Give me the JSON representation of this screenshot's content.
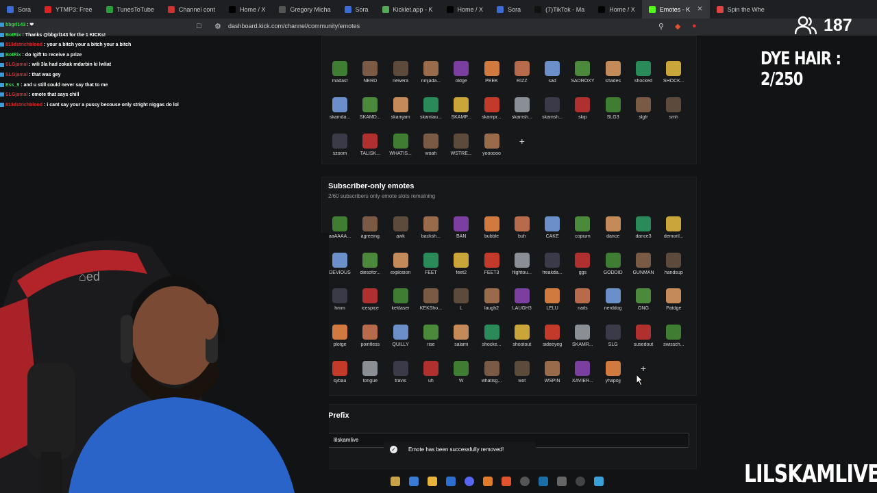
{
  "browser": {
    "tabs": [
      {
        "label": "Sora",
        "icon": "sora-icon",
        "color": "#3a6bd6"
      },
      {
        "label": "YTMP3: Free",
        "icon": "ytmp3-icon",
        "color": "#d22"
      },
      {
        "label": "TunesToTube",
        "icon": "tunestotube-icon",
        "color": "#2a9d3a"
      },
      {
        "label": "Channel cont",
        "icon": "channel-icon",
        "color": "#c33"
      },
      {
        "label": "Home / X",
        "icon": "x-icon",
        "color": "#000"
      },
      {
        "label": "Gregory Micha",
        "icon": "page-icon",
        "color": "#555"
      },
      {
        "label": "Sora",
        "icon": "sora-icon",
        "color": "#3a6bd6"
      },
      {
        "label": "Kicklet.app - K",
        "icon": "kicklet-icon",
        "color": "#5a5"
      },
      {
        "label": "Home / X",
        "icon": "x-icon",
        "color": "#000"
      },
      {
        "label": "Sora",
        "icon": "sora-icon",
        "color": "#3a6bd6"
      },
      {
        "label": "(7)TikTok - Ma",
        "icon": "tiktok-icon",
        "color": "#111"
      },
      {
        "label": "Home / X",
        "icon": "x-icon",
        "color": "#000"
      },
      {
        "label": "Emotes - K",
        "icon": "kick-icon",
        "color": "#53fc18",
        "active": true
      },
      {
        "label": "Spin the Whe",
        "icon": "wheel-icon",
        "color": "#d44"
      }
    ],
    "url": "dashboard.kick.com/channel/community/emotes"
  },
  "overlay": {
    "viewer_count": "187",
    "dye_hair": "DYE HAIR : 2/250",
    "streamer_name": "LILSKAMLIVE"
  },
  "chat": [
    {
      "user": "bbgrl143",
      "msg": "❤",
      "red": false
    },
    {
      "user": "BotRix",
      "msg": "Thanks @bbgrl143 for the 1 KICKs!",
      "red": false
    },
    {
      "user": "813dstrichblood",
      "msg": "your a bitch your a bitch your a bitch",
      "red": true
    },
    {
      "user": "BotRix",
      "msg": "do !gift to receive a prize",
      "red": false
    },
    {
      "user": "SLGjamal",
      "msg": "wili 3la had zokak mdarbin ki lwliat",
      "red": true
    },
    {
      "user": "SLGjamal",
      "msg": "that was gey",
      "red": true
    },
    {
      "user": "Ess_9",
      "msg": "and u still could never say that to me",
      "red": false
    },
    {
      "user": "SLGjamal",
      "msg": "emote that says chill",
      "red": true
    },
    {
      "user": "813dstrichblood",
      "msg": "i cant say your a pussy becouse only stright niggas do lol",
      "red": true
    }
  ],
  "emotes_top": {
    "rows": [
      [
        "madasf",
        "NERD",
        "newera",
        "ninjada...",
        "oldge",
        "PEEK",
        "RIZZ",
        "sad",
        "SADROXY",
        "shades",
        "shocked",
        "SHOCK..."
      ],
      [
        "skamda...",
        "SKAMD...",
        "skamjam",
        "skamlau...",
        "SKAMP...",
        "skampr...",
        "skamsh...",
        "skamsh...",
        "skip",
        "SLG3",
        "slgfr",
        "smh"
      ],
      [
        "szoom",
        "TALISK...",
        "WHATIS...",
        "woah",
        "WSTRE...",
        "yoooooo"
      ]
    ]
  },
  "subscriber": {
    "title": "Subscriber-only emotes",
    "subtitle": "2/60 subscribers only emote slots remaining",
    "rows": [
      [
        "aaAAAA...",
        "agreeing",
        "awk",
        "backsh...",
        "BAN",
        "bubble",
        "buh",
        "CAKE",
        "copium",
        "dance",
        "dance3",
        "demonl..."
      ],
      [
        "DEVIOUS",
        "diesofcr...",
        "explosion",
        "FEET",
        "feet2",
        "FEET3",
        "flightou...",
        "freakda...",
        "ggs",
        "GODDID",
        "GUNMAN",
        "handsup"
      ],
      [
        "hmm",
        "icespice",
        "keklaser",
        "KEKSho...",
        "L",
        "laugh2",
        "LAUGH3",
        "LELU",
        "nails",
        "nerddog",
        "ONG",
        "Patdge"
      ],
      [
        "plotge",
        "pointless",
        "QUILLY",
        "rise",
        "salami",
        "shocke...",
        "shootout",
        "sideeyeg",
        "SKAMR...",
        "SLG",
        "susedout",
        "swissch..."
      ],
      [
        "sybau",
        "tongue",
        "travis",
        "uh",
        "W",
        "whatisg...",
        "wot",
        "WSPIN",
        "XAVIER...",
        "yhapojj"
      ]
    ]
  },
  "prefix": {
    "title": "Prefix",
    "value": "lilskamlive"
  },
  "toast": {
    "message": "Emote has been successfully removed!"
  }
}
